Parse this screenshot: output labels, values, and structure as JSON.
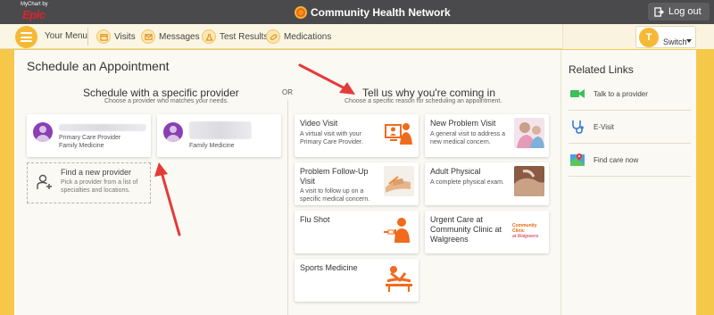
{
  "topbar": {
    "mychart_small": "MyChart by",
    "epic": "Epic",
    "brand": "Community Health Network",
    "logout": "Log out"
  },
  "nav": {
    "menu_label": "Your Menu",
    "items": [
      {
        "label": "Visits",
        "icon": "calendar-icon"
      },
      {
        "label": "Messages",
        "icon": "envelope-icon"
      },
      {
        "label": "Test Results",
        "icon": "flask-icon"
      },
      {
        "label": "Medications",
        "icon": "pill-icon"
      }
    ],
    "switch_initial": "T",
    "switch_label": "Switch"
  },
  "main": {
    "title": "Schedule an Appointment",
    "or": "OR",
    "provider_section": {
      "title": "Schedule with a specific provider",
      "subtitle": "Choose a provider who matches your needs."
    },
    "reason_section": {
      "title": "Tell us why you're coming in",
      "subtitle": "Choose a specific reason for scheduling an appointment."
    },
    "providers": [
      {
        "line1": "Primary Care Provider",
        "line2": "Family Medicine"
      },
      {
        "line1": "Family Medicine"
      }
    ],
    "find_provider": {
      "title": "Find a new provider",
      "desc1": "Pick a provider from a list of",
      "desc2": "specialties and locations."
    },
    "reasons": [
      {
        "title1": "Video Visit",
        "title2": "",
        "desc1": "A virtual visit with your",
        "desc2": "Primary Care Provider."
      },
      {
        "title1": "New Problem Visit",
        "title2": "",
        "desc1": "A general visit to address a",
        "desc2": "new medical concern."
      },
      {
        "title1": "Problem Follow-Up",
        "title2": "Visit",
        "desc1": "A visit to follow up on a",
        "desc2": "specific medical concern."
      },
      {
        "title1": "Adult Physical",
        "title2": "",
        "desc1": "A complete physical exam.",
        "desc2": ""
      },
      {
        "title1": "Flu Shot",
        "title2": "",
        "desc1": "",
        "desc2": ""
      },
      {
        "title1": "Urgent Care at",
        "title2": "Community Clinic at",
        "title3": "Walgreens",
        "desc1": "",
        "desc2": ""
      },
      {
        "title1": "Sports Medicine",
        "title2": "",
        "desc1": "",
        "desc2": ""
      }
    ],
    "clinic_logo": {
      "line1": "Community",
      "line2": "Clinic",
      "line3": "at Walgreens"
    }
  },
  "related_links": {
    "title": "Related Links",
    "items": [
      {
        "label": "Talk to a provider",
        "icon": "video-camera-icon"
      },
      {
        "label": "E-Visit",
        "icon": "stethoscope-icon"
      },
      {
        "label": "Find care now",
        "icon": "map-icon"
      }
    ]
  },
  "colors": {
    "accent": "#f5b935",
    "topbar": "#4a4a4c",
    "avatar": "#8a3fb2",
    "arrow": "#e53a3a"
  }
}
